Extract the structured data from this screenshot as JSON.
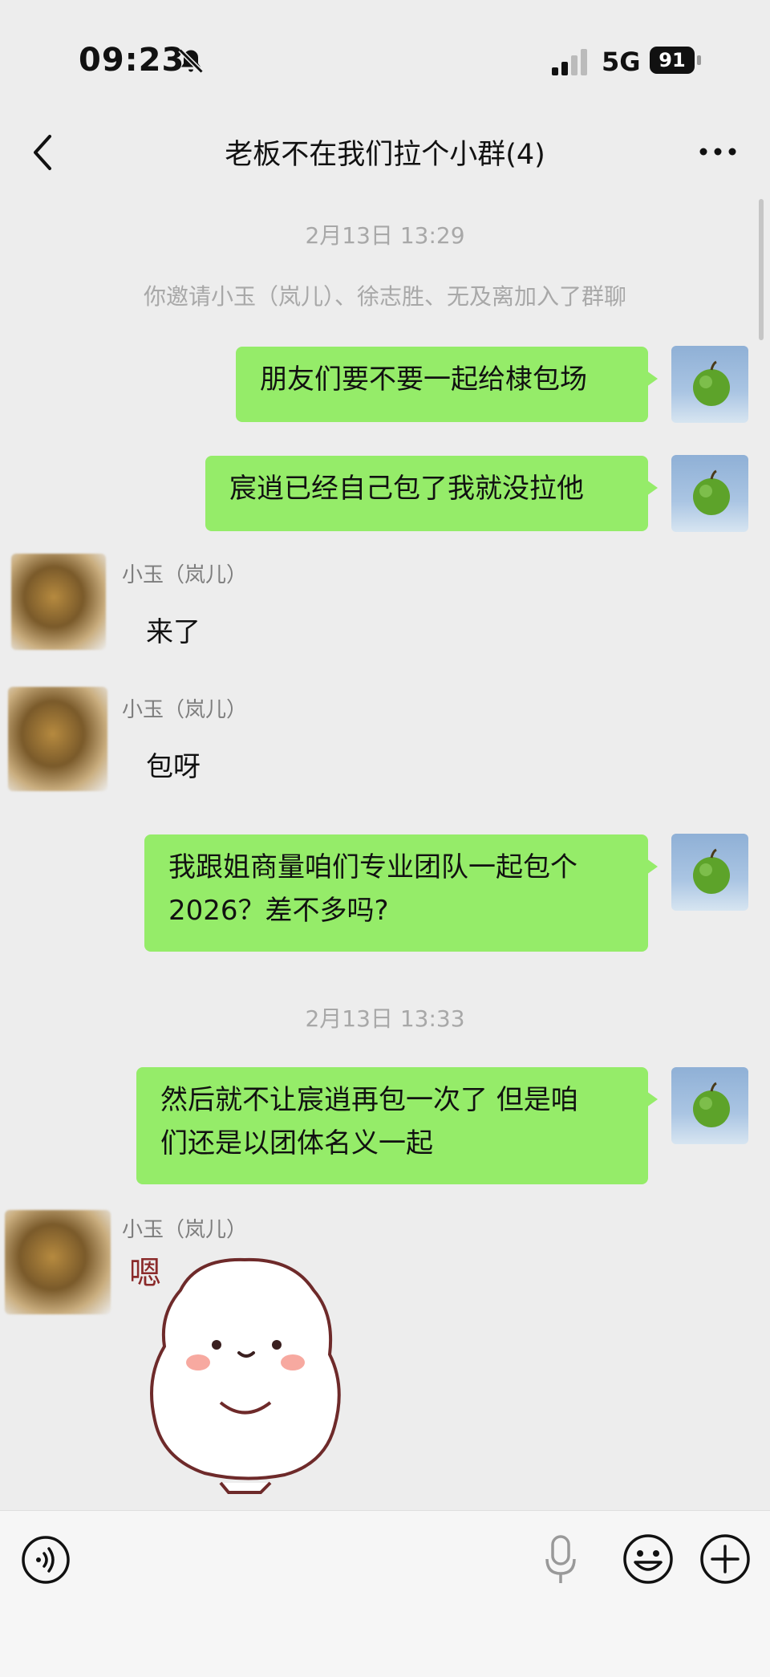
{
  "status": {
    "time": "09:23",
    "network": "5G",
    "battery": "91"
  },
  "nav": {
    "title": "老板不在我们拉个小群(4)"
  },
  "messages": {
    "ts1": "2月13日 13:29",
    "system_notice": "你邀请小玉（岚儿）、徐志胜、无及离加入了群聊",
    "m1": "朋友们要不要一起给棣包场",
    "m2": "宸逍已经自己包了我就没拉他",
    "sender1": "小玉（岚儿）",
    "m3": "来了",
    "sender2": "小玉（岚儿）",
    "m4": "包呀",
    "m5_line1": "我跟姐商量咱们专业团队一起包个",
    "m5_line2": "2026？差不多吗?",
    "ts2": "2月13日 13:33",
    "m6_line1": "然后就不让宸逍再包一次了 但是咱",
    "m6_line2": "们还是以团体名义一起",
    "sender3": "小玉（岚儿）",
    "sticker_label": "嗯"
  },
  "colors": {
    "bubble_self": "#95ec69",
    "background": "#ededed"
  },
  "icons": {
    "back": "chevron-left-icon",
    "more": "more-dots-icon",
    "voice": "voice-icon",
    "mic": "microphone-icon",
    "emoji": "emoji-icon",
    "plus": "plus-icon"
  }
}
